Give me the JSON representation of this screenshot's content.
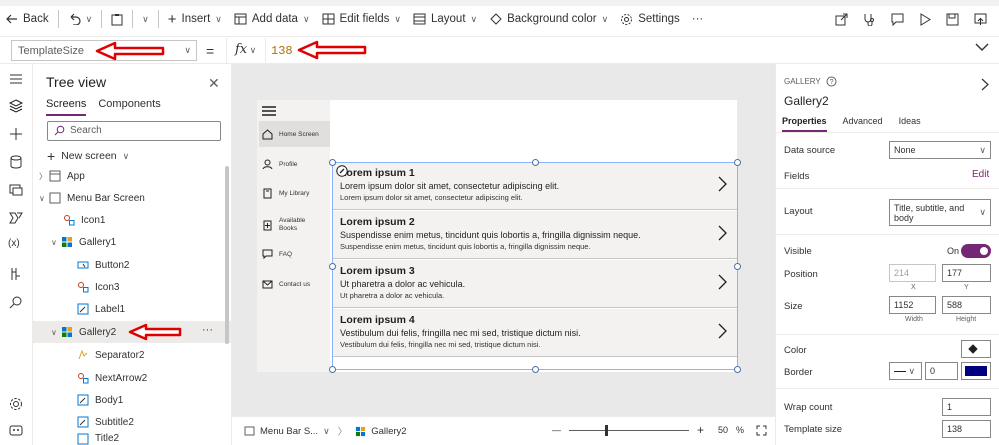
{
  "colors": {
    "accent": "#742774",
    "annotation": "#e00000",
    "selection": "#8ab4f8",
    "border_swatch": "#000080"
  },
  "command_bar": {
    "back": "Back",
    "insert": "Insert",
    "add_data": "Add data",
    "edit_fields": "Edit fields",
    "layout": "Layout",
    "background_color": "Background color",
    "settings": "Settings",
    "more": "···"
  },
  "formula_bar": {
    "property": "TemplateSize",
    "equals": "=",
    "fx": "fx",
    "value": "138"
  },
  "tree": {
    "title": "Tree view",
    "tabs": [
      "Screens",
      "Components"
    ],
    "search_placeholder": "Search",
    "new_screen": "New screen",
    "nodes": [
      "App",
      "Menu Bar Screen",
      "Icon1",
      "Gallery1",
      "Button2",
      "Icon3",
      "Label1",
      "Gallery2",
      "Separator2",
      "NextArrow2",
      "Body1",
      "Subtitle2",
      "Title2"
    ],
    "more": "···"
  },
  "menu": {
    "items": [
      "Home Screen",
      "Profile",
      "My Library",
      "Available Books",
      "FAQ",
      "Contact us"
    ]
  },
  "gallery": {
    "rows": [
      {
        "title": "Lorem ipsum 1",
        "subtitle": "Lorem ipsum dolor sit amet, consectetur adipiscing elit.",
        "body": "Lorem ipsum dolor sit amet, consectetur adipiscing elit."
      },
      {
        "title": "Lorem ipsum 2",
        "subtitle": "Suspendisse enim metus, tincidunt quis lobortis a, fringilla dignissim neque.",
        "body": "Suspendisse enim metus, tincidunt quis lobortis a, fringilla dignissim neque."
      },
      {
        "title": "Lorem ipsum 3",
        "subtitle": "Ut pharetra a dolor ac vehicula.",
        "body": "Ut pharetra a dolor ac vehicula."
      },
      {
        "title": "Lorem ipsum 4",
        "subtitle": "Vestibulum dui felis, fringilla nec mi sed, tristique dictum nisi.",
        "body": "Vestibulum dui felis, fringilla nec mi sed, tristique dictum nisi."
      }
    ]
  },
  "bottom": {
    "screen": "Menu Bar S...",
    "gallery": "Gallery2",
    "minus": "—",
    "plus": "+",
    "zoom": "50",
    "pct": "%"
  },
  "props": {
    "kind": "GALLERY",
    "name": "Gallery2",
    "tabs": [
      "Properties",
      "Advanced",
      "Ideas"
    ],
    "data_source_label": "Data source",
    "data_source": "None",
    "fields_label": "Fields",
    "fields_edit": "Edit",
    "layout_label": "Layout",
    "layout": "Title, subtitle, and body",
    "visible_label": "Visible",
    "visible": "On",
    "position_label": "Position",
    "x": "214",
    "y": "177",
    "x_label": "X",
    "y_label": "Y",
    "size_label": "Size",
    "width": "1152",
    "height": "588",
    "width_label": "Width",
    "height_label": "Height",
    "color_label": "Color",
    "border_label": "Border",
    "border_width": "0",
    "wrap_label": "Wrap count",
    "wrap": "1",
    "template_label": "Template size",
    "template": "138"
  }
}
